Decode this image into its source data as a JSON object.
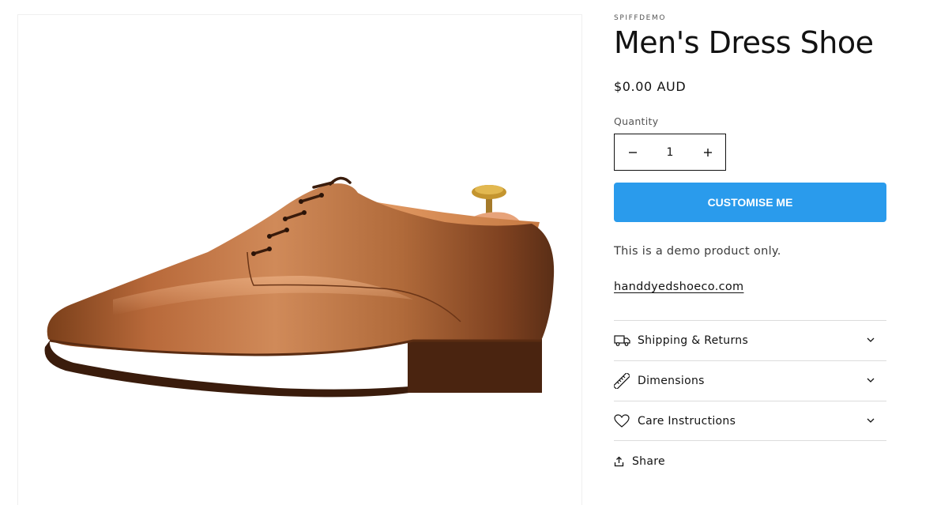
{
  "product": {
    "vendor": "SPIFFDEMO",
    "title": "Men's Dress Shoe",
    "price": "$0.00 AUD",
    "image_alt": "Men's Dress Shoe"
  },
  "quantity": {
    "label": "Quantity",
    "value": "1",
    "decrease_icon": "minus-icon",
    "increase_icon": "plus-icon"
  },
  "actions": {
    "customise_label": "CUSTOMISE ME",
    "customise_color": "#2a9bec",
    "share_label": "Share",
    "share_icon": "share-icon"
  },
  "description": {
    "text": "This is a demo product only.",
    "link": "handdyedshoeco.com"
  },
  "accordion": [
    {
      "label": "Shipping & Returns",
      "icon": "truck-icon"
    },
    {
      "label": "Dimensions",
      "icon": "ruler-icon"
    },
    {
      "label": "Care Instructions",
      "icon": "heart-icon"
    }
  ]
}
